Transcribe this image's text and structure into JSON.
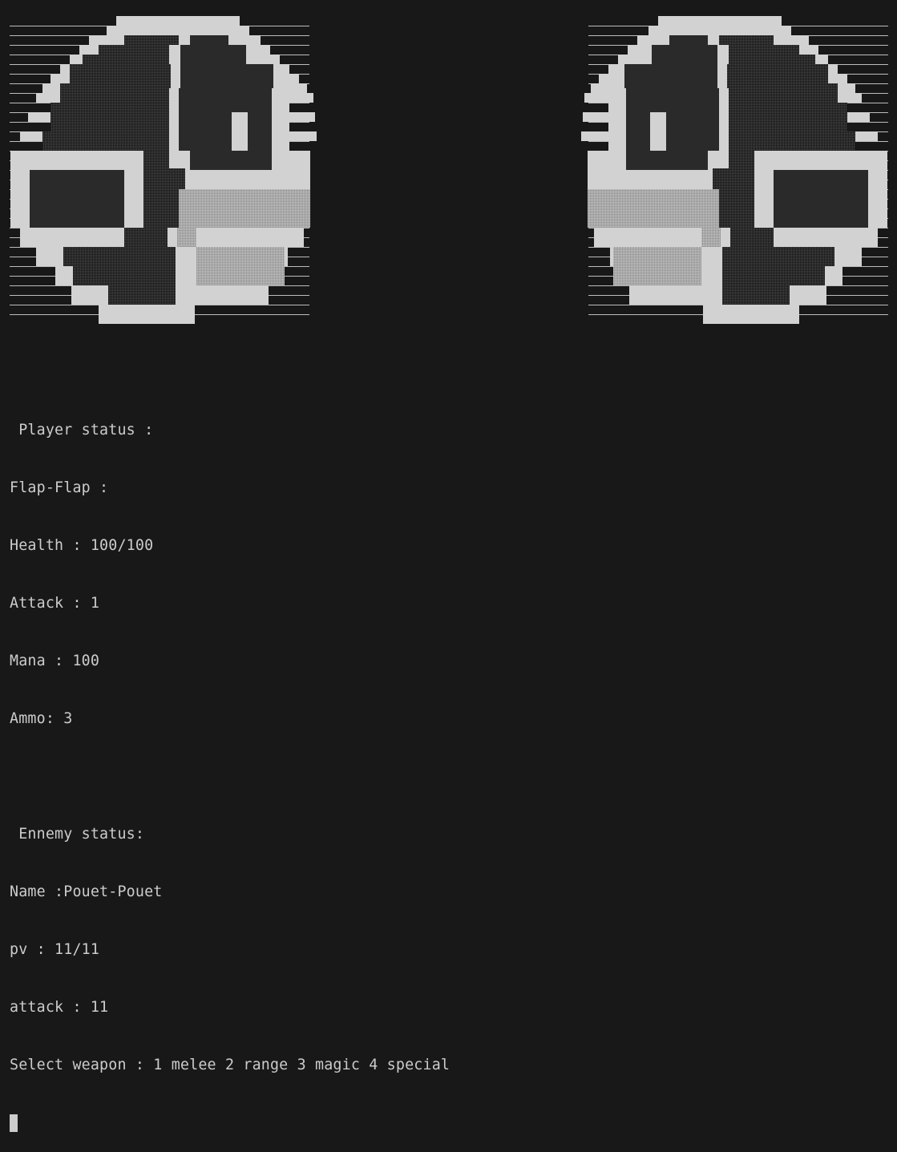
{
  "theme": {
    "background": "#181818",
    "foreground": "#cccccc",
    "sprite_light": "#d2d2d2",
    "sprite_dark": "#2a2a2a"
  },
  "sprites": {
    "left": {
      "icon": "player-portrait-icon"
    },
    "right": {
      "icon": "enemy-portrait-icon"
    }
  },
  "player": {
    "header": " Player status :",
    "name_line": "Flap-Flap :",
    "health_line": "Health : 100/100",
    "attack_line": "Attack : 1",
    "mana_line": "Mana : 100",
    "ammo_line": "Ammo: 3"
  },
  "enemy": {
    "header": " Ennemy status:",
    "name_line": "Name :Pouet-Pouet",
    "pv_line": "pv : 11/11",
    "attack_line": "attack : 11"
  },
  "prompt": {
    "weapon_select": "Select weapon : 1 melee 2 range 3 magic 4 special"
  }
}
